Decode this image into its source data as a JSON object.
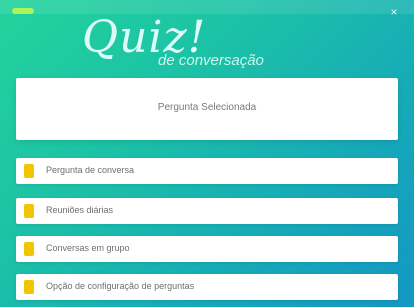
{
  "header": {
    "logo_text": "Quiz!",
    "logo_subtitle": "de conversação",
    "close_symbol": "×",
    "colors": {
      "gradient_start": "#22d39b",
      "gradient_end": "#1497c4",
      "accent": "#a9f55c",
      "marker": "#f2c500"
    }
  },
  "main_card": {
    "label": "Pergunta Selecionada"
  },
  "options": [
    {
      "label": "Pergunta de conversa",
      "icon": "folder-icon"
    },
    {
      "label": "Reuniões diárias",
      "icon": "folder-icon"
    },
    {
      "label": "Conversas em grupo",
      "icon": "folder-icon"
    },
    {
      "label": "Opção de configuração de perguntas",
      "icon": "folder-icon"
    }
  ]
}
